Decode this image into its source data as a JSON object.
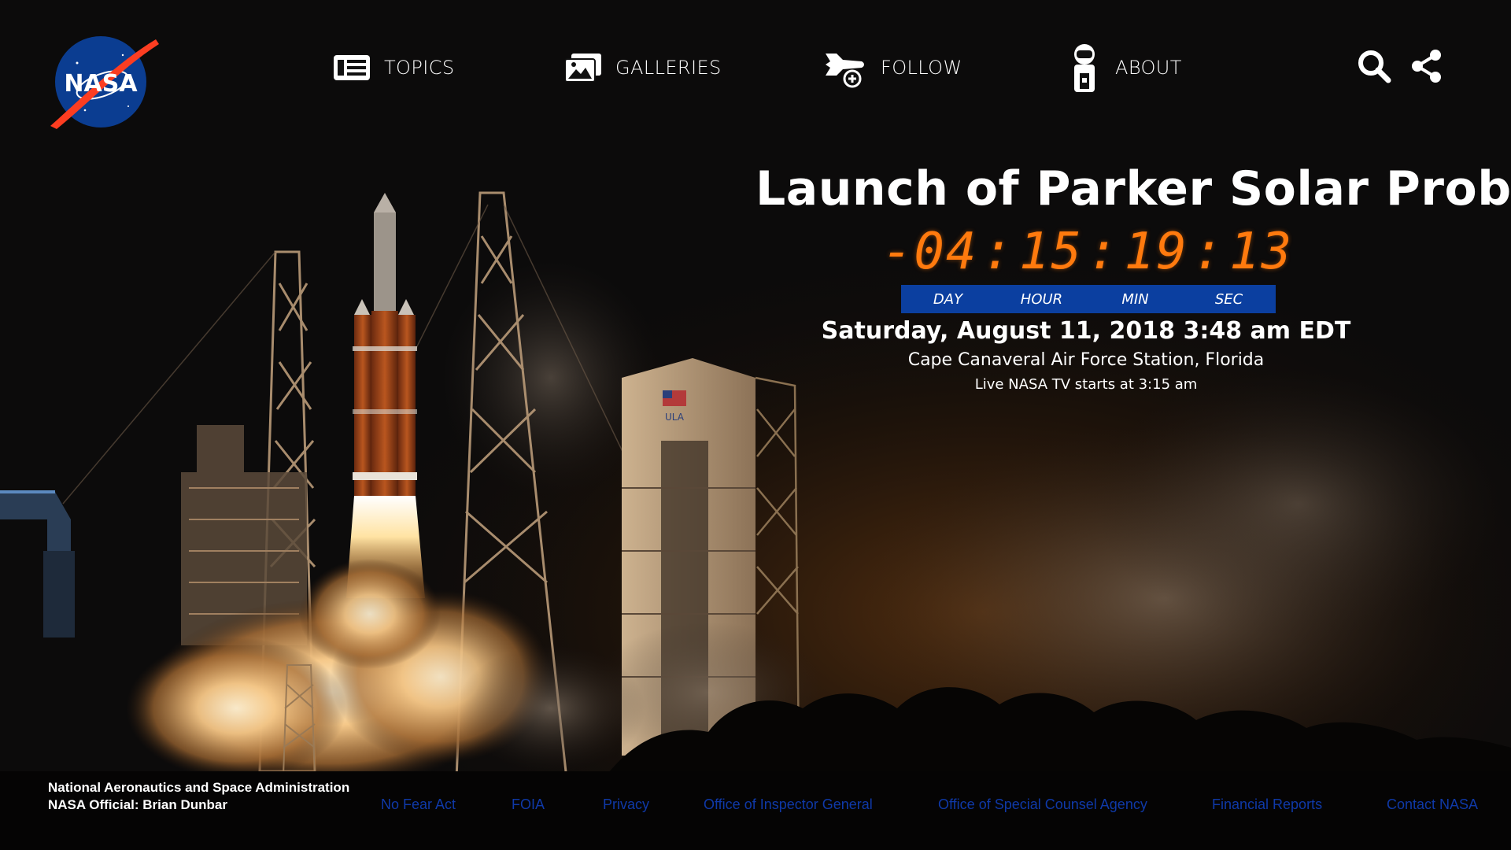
{
  "header": {
    "logo_text": "NASA",
    "nav": [
      {
        "label": "TOPICS",
        "icon": "newspaper-icon"
      },
      {
        "label": "GALLERIES",
        "icon": "image-gallery-icon"
      },
      {
        "label": "FOLLOW",
        "icon": "space-shuttle-follow-icon"
      },
      {
        "label": "ABOUT",
        "icon": "astronaut-icon"
      }
    ],
    "utilities": [
      {
        "icon": "search-icon"
      },
      {
        "icon": "share-icon"
      }
    ]
  },
  "launch": {
    "title": "Launch of Parker Solar Probe",
    "countdown": {
      "sign": "-",
      "days": "04",
      "hours": "15",
      "minutes": "19",
      "seconds": "13",
      "separator": ":"
    },
    "units": [
      "DAY",
      "HOUR",
      "MIN",
      "SEC"
    ],
    "date": "Saturday, August 11, 2018 3:48 am EDT",
    "site": "Cape Canaveral Air Force Station, Florida",
    "tv": "Live NASA TV starts at 3:15 am"
  },
  "footer": {
    "org_line1": "National Aeronautics and Space Administration",
    "org_line2": "NASA Official: Brian Dunbar",
    "links": [
      "No Fear Act",
      "FOIA",
      "Privacy",
      "Office of Inspector General",
      "Office of Special Counsel Agency",
      "Financial Reports",
      "Contact NASA"
    ]
  },
  "colors": {
    "countdown": "#ff7a0e",
    "unit_bar": "#0b3fa0",
    "footer_link": "#0f39a8",
    "nasa_blue": "#0b3d91",
    "nasa_red": "#fc3d21"
  }
}
